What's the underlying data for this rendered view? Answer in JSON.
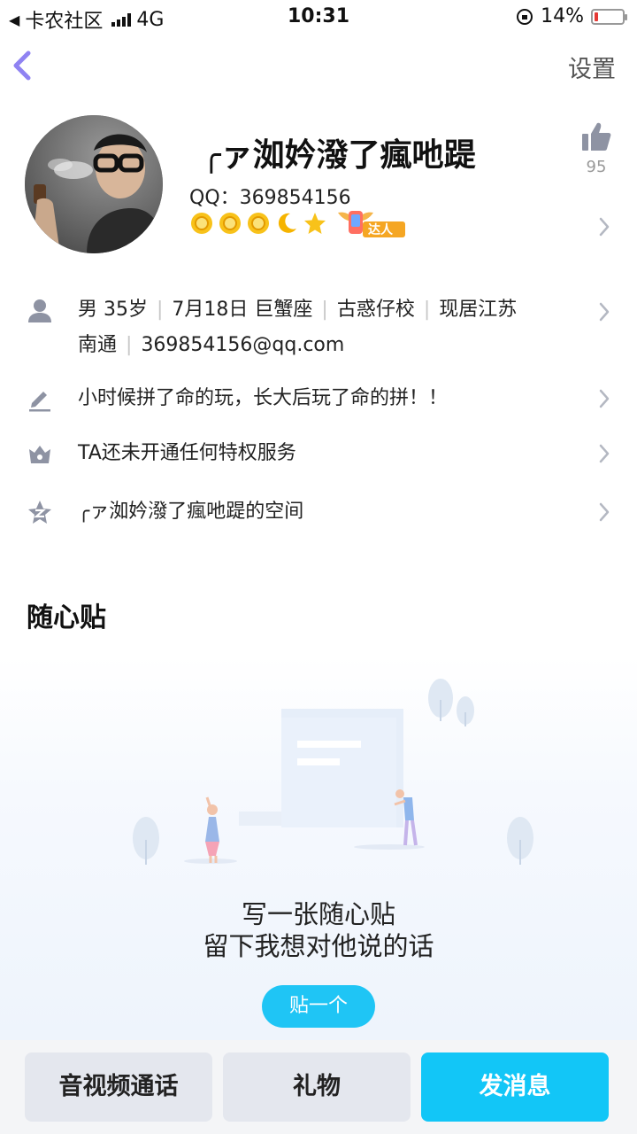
{
  "status_bar": {
    "carrier": "卡农社区",
    "network": "4G",
    "time": "10:31",
    "battery": "14%",
    "battery_level": 0.14
  },
  "nav": {
    "settings_label": "设置"
  },
  "profile": {
    "nickname": "╭ァ洳妗潑了瘋吔踶",
    "qq_line": "QQ：369854156",
    "like_count": "95",
    "level_icons": [
      "sun-icon",
      "sun-icon",
      "sun-icon",
      "moon-icon",
      "star-icon"
    ],
    "badge_label": "达人"
  },
  "info": {
    "gender_age": "男 35岁",
    "birthday": "7月18日 巨蟹座",
    "hometown": "古惑仔校",
    "residence_line1": "现居江苏",
    "residence_line2": "南通",
    "email": "369854156@qq.com",
    "signature": "小时候拼了命的玩，长大后玩了命的拼！！",
    "privilege": "TA还未开通任何特权服务",
    "space": "╭ァ洳妗潑了瘋吔踶的空间"
  },
  "notes_section": {
    "title": "随心贴",
    "empty_line1": "写一张随心贴",
    "empty_line2": "留下我想对他说的话",
    "post_button": "贴一个"
  },
  "bottom_bar": {
    "call_label": "音视频通话",
    "gift_label": "礼物",
    "message_label": "发消息"
  },
  "colors": {
    "accent": "#12c6f7",
    "back_arrow": "#8f82f2",
    "icon_gray": "#8e93a3"
  }
}
